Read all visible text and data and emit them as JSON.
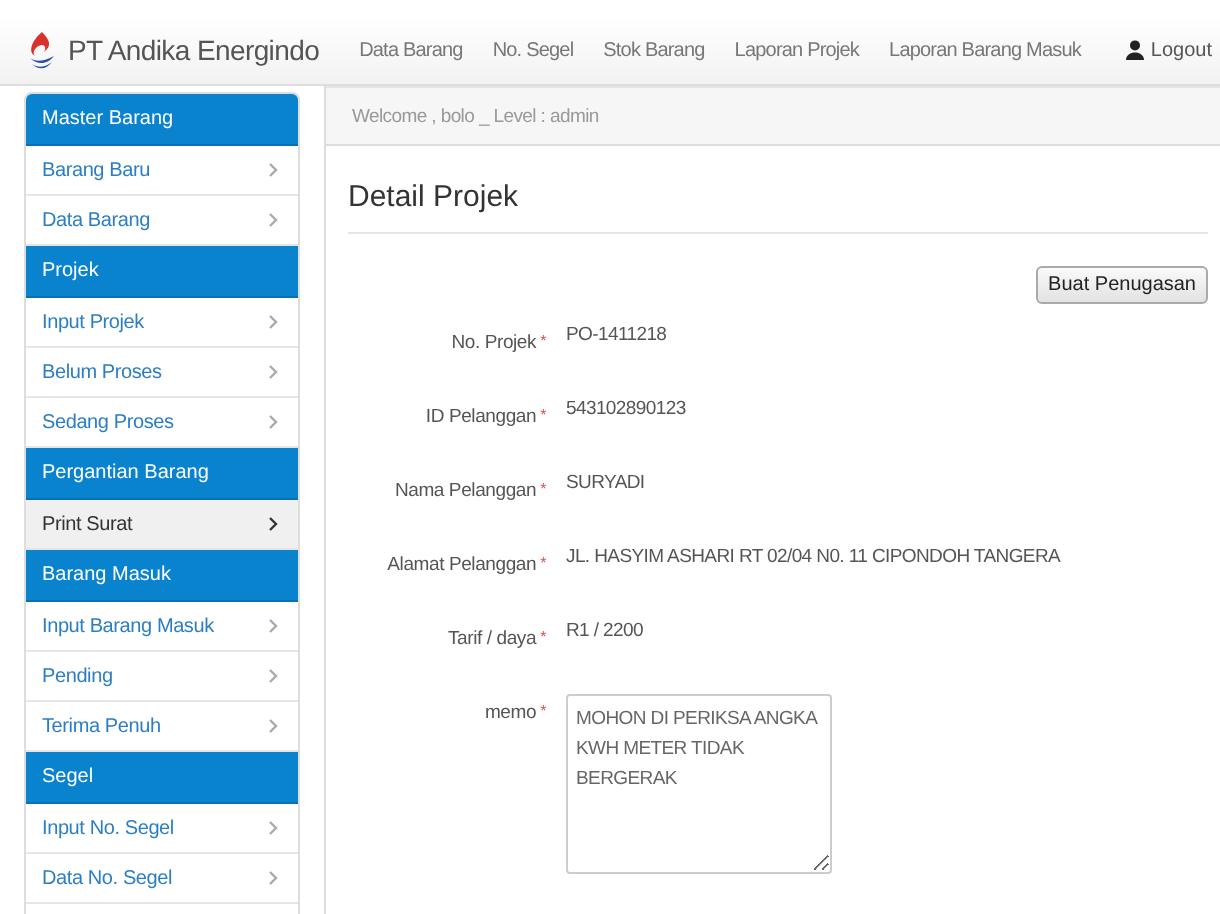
{
  "navbar": {
    "brand": "PT Andika Energindo",
    "links": [
      "Data Barang",
      "No. Segel",
      "Stok Barang",
      "Laporan Projek",
      "Laporan Barang Masuk"
    ],
    "logout": "Logout"
  },
  "sidebar": {
    "items": [
      {
        "kind": "header",
        "label": "Master Barang"
      },
      {
        "kind": "item",
        "label": "Barang Baru",
        "selected": false
      },
      {
        "kind": "item",
        "label": "Data Barang",
        "selected": false
      },
      {
        "kind": "header",
        "label": "Projek"
      },
      {
        "kind": "item",
        "label": "Input Projek",
        "selected": false
      },
      {
        "kind": "item",
        "label": "Belum Proses",
        "selected": false
      },
      {
        "kind": "item",
        "label": "Sedang Proses",
        "selected": false
      },
      {
        "kind": "header",
        "label": "Pergantian Barang"
      },
      {
        "kind": "item",
        "label": "Print Surat",
        "selected": true
      },
      {
        "kind": "header",
        "label": "Barang Masuk"
      },
      {
        "kind": "item",
        "label": "Input Barang Masuk",
        "selected": false
      },
      {
        "kind": "item",
        "label": "Pending",
        "selected": false
      },
      {
        "kind": "item",
        "label": "Terima Penuh",
        "selected": false
      },
      {
        "kind": "header",
        "label": "Segel"
      },
      {
        "kind": "item",
        "label": "Input No. Segel",
        "selected": false
      },
      {
        "kind": "item",
        "label": "Data No. Segel",
        "selected": false
      }
    ]
  },
  "welcome": "Welcome , bolo _ Level : admin",
  "page_title": "Detail Projek",
  "action_button": "Buat Penugasan",
  "fields": [
    {
      "kind": "text",
      "label": "No. Projek",
      "required_mark": "*",
      "value": "PO-1411218"
    },
    {
      "kind": "text",
      "label": "ID Pelanggan",
      "required_mark": "*",
      "value": "543102890123"
    },
    {
      "kind": "text",
      "label": "Nama Pelanggan",
      "required_mark": "*",
      "value": "SURYADI"
    },
    {
      "kind": "text",
      "label": "Alamat Pelanggan",
      "required_mark": "*",
      "value": "JL. HASYIM ASHARI RT 02/04 N0. 11 CIPONDOH TANGERA"
    },
    {
      "kind": "text",
      "label": "Tarif / daya",
      "required_mark": "*",
      "value": "R1 / 2200"
    },
    {
      "kind": "textarea",
      "label": "memo",
      "required_mark": "*",
      "value": "MOHON DI PERIKSA ANGKA\nKWH METER TIDAK\nBERGERAK"
    }
  ]
}
